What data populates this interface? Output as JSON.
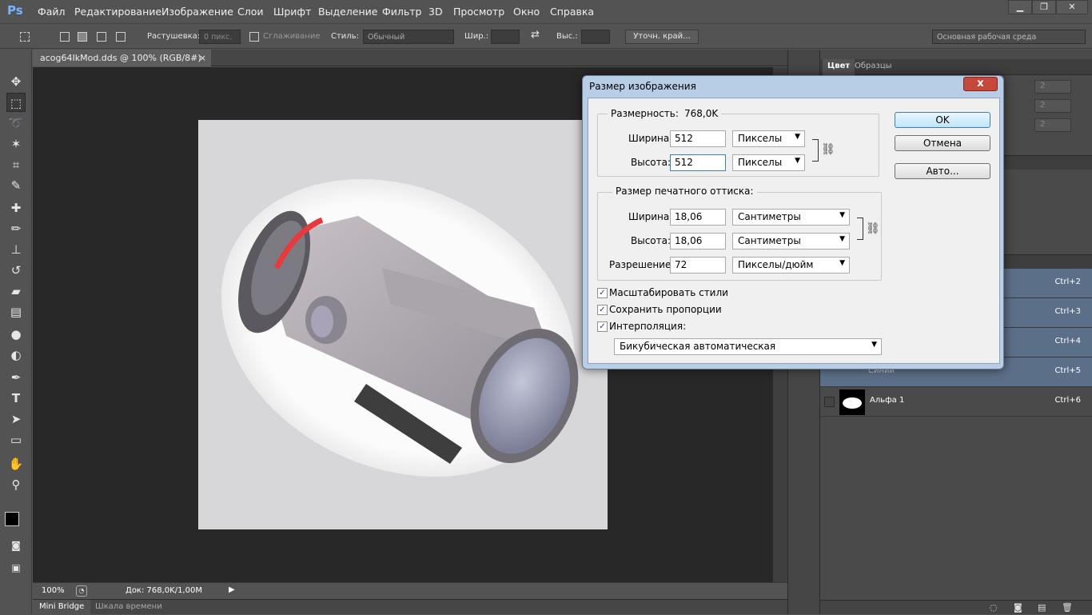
{
  "app": {
    "logo": "Ps",
    "menu": [
      "Файл",
      "Редактирование",
      "Изображение",
      "Слои",
      "Шрифт",
      "Выделение",
      "Фильтр",
      "3D",
      "Просмотр",
      "Окно",
      "Справка"
    ]
  },
  "options_bar": {
    "feather_label": "Растушевка:",
    "feather_value": "0 пикс.",
    "antialias_label": "Сглаживание",
    "style_label": "Стиль:",
    "style_value": "Обычный",
    "width_label": "Шир.:",
    "height_label": "Выс.:",
    "refine_button": "Уточн. край...",
    "workspace": "Основная рабочая среда"
  },
  "document": {
    "tab_title": "acog64IkMod.dds @ 100% (RGB/8#)",
    "zoom": "100%",
    "doc_size": "Док: 768,0K/1,00M"
  },
  "bottom_tabs": [
    "Mini Bridge",
    "Шкала времени"
  ],
  "panels": {
    "tabs": [
      "Цвет",
      "Образцы"
    ],
    "rgb_values": [
      "2",
      "2",
      "2"
    ],
    "channels": [
      {
        "name": "",
        "shortcut": "Ctrl+2"
      },
      {
        "name": "",
        "shortcut": "Ctrl+3"
      },
      {
        "name": "",
        "shortcut": "Ctrl+4"
      },
      {
        "name": "Синий",
        "shortcut": "Ctrl+5"
      },
      {
        "name": "Альфа 1",
        "shortcut": "Ctrl+6"
      }
    ]
  },
  "dialog": {
    "title": "Размер изображения",
    "pixel_dims_label": "Размерность:",
    "pixel_dims_value": "768,0K",
    "width_label": "Ширина:",
    "height_label": "Высота:",
    "px_width": "512",
    "px_height": "512",
    "px_unit": "Пикселы",
    "print_label": "Размер печатного оттиска:",
    "print_width": "18,06",
    "print_height": "18,06",
    "print_unit": "Сантиметры",
    "resolution_label": "Разрешение:",
    "resolution": "72",
    "resolution_unit": "Пикселы/дюйм",
    "scale_styles": "Масштабировать стили",
    "constrain": "Сохранить пропорции",
    "resample": "Интерполяция:",
    "resample_method": "Бикубическая автоматическая",
    "ok": "OK",
    "cancel": "Отмена",
    "auto": "Авто...",
    "close": "x"
  },
  "colors": {
    "accent": "#78b4ff",
    "selected_row": "#5c6f88"
  }
}
